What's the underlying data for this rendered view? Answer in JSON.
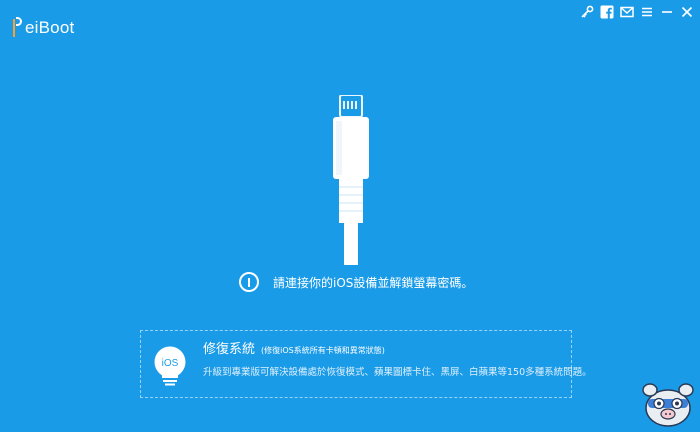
{
  "app": {
    "title": "ReiBoot",
    "logo_rest": "eiBoot"
  },
  "window_controls": {
    "icons": [
      "key-icon",
      "facebook-icon",
      "mail-icon",
      "menu-icon",
      "minimize-icon",
      "close-icon"
    ]
  },
  "prompt": {
    "text": "請連接你的iOS設備並解鎖螢幕密碼。"
  },
  "repair": {
    "title": "修復系統",
    "subtitle": "(修復iOS系統所有卡頓和異常狀態)",
    "description": "升級到專業版可解決設備處於恢復模式、蘋果圖標卡住、黑屏、白蘋果等150多種系統問題。",
    "badge": "iOS"
  },
  "colors": {
    "background": "#1a9be8",
    "logo_accent": "#ff9f2e",
    "text": "#ffffff"
  }
}
